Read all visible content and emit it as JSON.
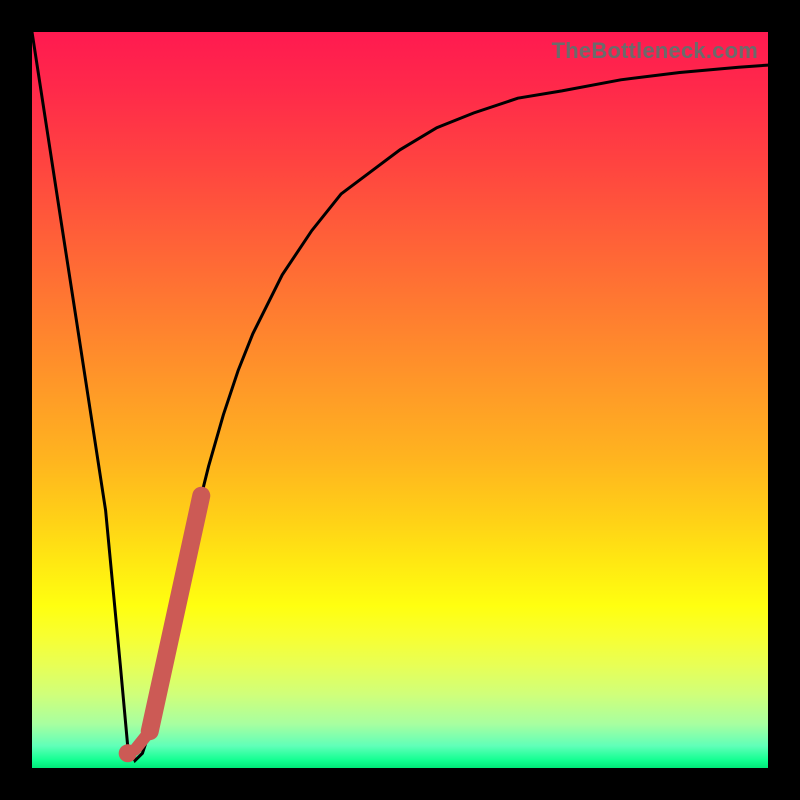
{
  "watermark": "TheBottleneck.com",
  "chart_data": {
    "type": "line",
    "title": "",
    "xlabel": "",
    "ylabel": "",
    "xlim": [
      0,
      100
    ],
    "ylim": [
      0,
      100
    ],
    "grid": false,
    "legend": false,
    "series": [
      {
        "name": "bottleneck-curve",
        "color": "#000000",
        "x": [
          0,
          2,
          4,
          6,
          8,
          10,
          12,
          13,
          14,
          15,
          16,
          18,
          20,
          22,
          24,
          26,
          28,
          30,
          34,
          38,
          42,
          46,
          50,
          55,
          60,
          66,
          72,
          80,
          88,
          96,
          100
        ],
        "y": [
          100,
          87,
          74,
          61,
          48,
          35,
          14,
          3,
          1,
          2,
          5,
          14,
          24,
          33,
          41,
          48,
          54,
          59,
          67,
          73,
          78,
          81,
          84,
          87,
          89,
          91,
          92,
          93.5,
          94.5,
          95.2,
          95.5
        ]
      }
    ],
    "annotations": [
      {
        "name": "highlight-segment",
        "type": "thick-line",
        "color": "#cc5a55",
        "x": [
          16,
          23
        ],
        "y": [
          5,
          37
        ]
      },
      {
        "name": "highlight-dot",
        "type": "dot",
        "color": "#cc5a55",
        "x": 13,
        "y": 2
      }
    ]
  }
}
